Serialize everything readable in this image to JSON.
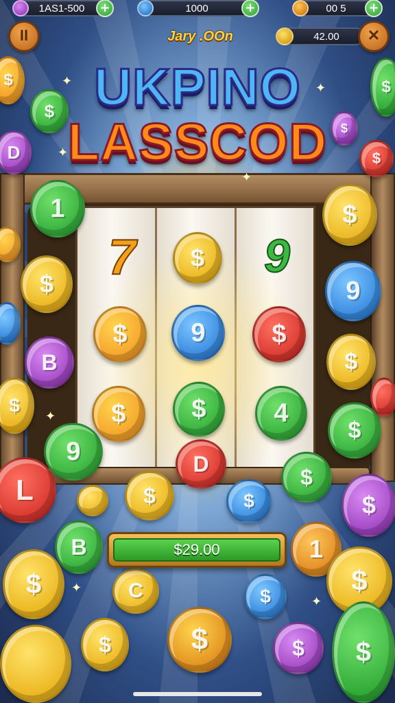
{
  "resources": [
    {
      "name": "gems",
      "value": "1AS1-500",
      "icon": "gem-icon",
      "color": "#b04ad8"
    },
    {
      "name": "blue-coins",
      "value": "1000",
      "icon": "blue-coin-icon",
      "color": "#2b8be0"
    },
    {
      "name": "gold-coins",
      "value": "00 5",
      "icon": "gold-coin-icon",
      "color": "#f09a1a"
    }
  ],
  "plus_label": "+",
  "pause_label": "II",
  "close_label": "✕",
  "player_name": "Jary .OOn",
  "balance": "42.00",
  "logo": {
    "line1": "UKPINO",
    "line2": "LASSCOD"
  },
  "reel_symbols": {
    "r1c1": "7",
    "r1c2": "$",
    "r1c3": "9",
    "r2c1": "$",
    "r2c2": "9",
    "r2c3": "$",
    "r3c1": "$",
    "r3c2": "$",
    "r3c3": "4",
    "r4c2": "D"
  },
  "coins_labels": {
    "one": "1",
    "b": "B",
    "l": "L",
    "c": "C",
    "d": "D",
    "dollar": "$",
    "nine": "9"
  },
  "win_amount": "$29.00",
  "colors": {
    "gold": "#f2c12e",
    "green": "#3cb843",
    "blue": "#2e90e0",
    "red": "#e0342c",
    "purple": "#9a3ad0",
    "orange": "#f08c1a"
  }
}
